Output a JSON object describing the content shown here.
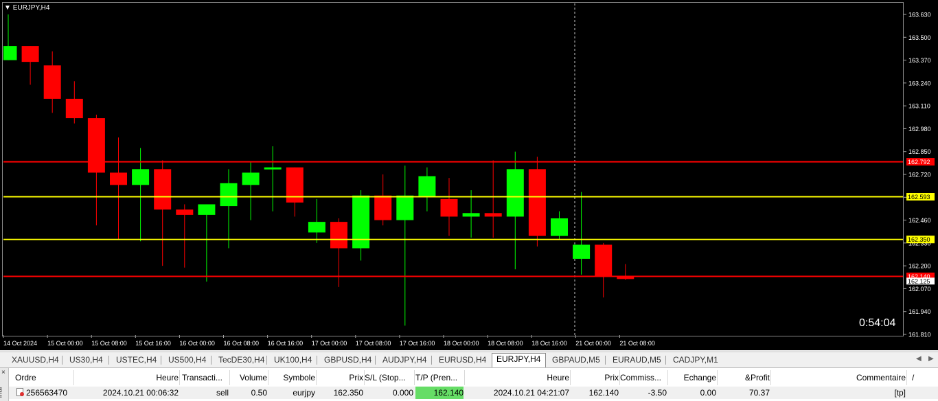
{
  "chart": {
    "symbol": "EURJPY,H4",
    "timer": "0:54:04",
    "colors": {
      "background": "#000000",
      "bull": "#00ff00",
      "bear": "#ff0000",
      "tp_sl_line": "#ff0000",
      "entry_line": "#ffff00"
    },
    "y_min": 161.81,
    "y_max": 163.63,
    "y_ticks": [
      "163.630",
      "163.500",
      "163.370",
      "163.240",
      "163.110",
      "162.980",
      "162.850",
      "162.720",
      "162.590",
      "162.460",
      "162.330",
      "162.200",
      "162.070",
      "161.940",
      "161.810"
    ],
    "x_labels": [
      "14 Oct 2024",
      "15 Oct 00:00",
      "15 Oct 08:00",
      "15 Oct 16:00",
      "16 Oct 00:00",
      "16 Oct 08:00",
      "16 Oct 16:00",
      "17 Oct 00:00",
      "17 Oct 08:00",
      "17 Oct 16:00",
      "18 Oct 00:00",
      "18 Oct 08:00",
      "18 Oct 16:00",
      "21 Oct 00:00",
      "21 Oct 08:00"
    ],
    "price_lines": [
      {
        "label": "162.792",
        "value": 162.792,
        "color": "#ff0000",
        "tag_text": "#ffffff"
      },
      {
        "label": "162.593",
        "value": 162.593,
        "color": "#ffff00",
        "tag_text": "#000000"
      },
      {
        "label": "162.350",
        "value": 162.35,
        "color": "#ffff00",
        "tag_text": "#000000"
      },
      {
        "label": "162.140",
        "value": 162.14,
        "color": "#ff0000",
        "tag_text": "#ffffff"
      }
    ],
    "current_price": "162.125",
    "candles": [
      {
        "o": 163.37,
        "h": 163.63,
        "l": 163.37,
        "c": 163.45
      },
      {
        "o": 163.45,
        "h": 163.45,
        "l": 163.23,
        "c": 163.36
      },
      {
        "o": 163.34,
        "h": 163.42,
        "l": 163.07,
        "c": 163.15
      },
      {
        "o": 163.15,
        "h": 163.25,
        "l": 163.01,
        "c": 163.04
      },
      {
        "o": 163.04,
        "h": 163.06,
        "l": 162.43,
        "c": 162.73
      },
      {
        "o": 162.73,
        "h": 162.93,
        "l": 162.35,
        "c": 162.66
      },
      {
        "o": 162.66,
        "h": 162.87,
        "l": 162.34,
        "c": 162.75
      },
      {
        "o": 162.75,
        "h": 162.8,
        "l": 162.2,
        "c": 162.52
      },
      {
        "o": 162.52,
        "h": 162.55,
        "l": 162.19,
        "c": 162.49
      },
      {
        "o": 162.49,
        "h": 162.55,
        "l": 162.11,
        "c": 162.55
      },
      {
        "o": 162.54,
        "h": 162.75,
        "l": 162.3,
        "c": 162.67
      },
      {
        "o": 162.66,
        "h": 162.79,
        "l": 162.46,
        "c": 162.73
      },
      {
        "o": 162.75,
        "h": 162.88,
        "l": 162.51,
        "c": 162.76
      },
      {
        "o": 162.76,
        "h": 162.76,
        "l": 162.48,
        "c": 162.56
      },
      {
        "o": 162.39,
        "h": 162.58,
        "l": 162.33,
        "c": 162.45
      },
      {
        "o": 162.45,
        "h": 162.47,
        "l": 162.08,
        "c": 162.3
      },
      {
        "o": 162.3,
        "h": 162.63,
        "l": 162.23,
        "c": 162.6
      },
      {
        "o": 162.6,
        "h": 162.72,
        "l": 162.43,
        "c": 162.46
      },
      {
        "o": 162.46,
        "h": 162.77,
        "l": 161.86,
        "c": 162.6
      },
      {
        "o": 162.59,
        "h": 162.76,
        "l": 162.51,
        "c": 162.71
      },
      {
        "o": 162.58,
        "h": 162.7,
        "l": 162.37,
        "c": 162.48
      },
      {
        "o": 162.48,
        "h": 162.63,
        "l": 162.36,
        "c": 162.5
      },
      {
        "o": 162.5,
        "h": 162.8,
        "l": 162.36,
        "c": 162.48
      },
      {
        "o": 162.48,
        "h": 162.85,
        "l": 162.18,
        "c": 162.75
      },
      {
        "o": 162.75,
        "h": 162.82,
        "l": 162.31,
        "c": 162.37
      },
      {
        "o": 162.37,
        "h": 162.51,
        "l": 162.35,
        "c": 162.47
      },
      {
        "o": 162.24,
        "h": 162.62,
        "l": 162.15,
        "c": 162.32
      },
      {
        "o": 162.32,
        "h": 162.33,
        "l": 162.02,
        "c": 162.14
      },
      {
        "o": 162.14,
        "h": 162.21,
        "l": 162.12,
        "c": 162.125
      }
    ]
  },
  "tabs": [
    {
      "label": "XAUUSD,H4",
      "active": false
    },
    {
      "label": "US30,H4",
      "active": false
    },
    {
      "label": "USTEC,H4",
      "active": false
    },
    {
      "label": "US500,H4",
      "active": false
    },
    {
      "label": "TecDE30,H4",
      "active": false
    },
    {
      "label": "UK100,H4",
      "active": false
    },
    {
      "label": "GBPUSD,H4",
      "active": false
    },
    {
      "label": "AUDJPY,H4",
      "active": false
    },
    {
      "label": "EURUSD,H4",
      "active": false
    },
    {
      "label": "EURJPY,H4",
      "active": true
    },
    {
      "label": "GBPAUD,M5",
      "active": false
    },
    {
      "label": "EURAUD,M5",
      "active": false
    },
    {
      "label": "CADJPY,M1",
      "active": false
    }
  ],
  "terminal": {
    "side_label": "inal",
    "close_icon": "×",
    "columns": [
      "Ordre",
      "Heure",
      "Transacti...",
      "Volume",
      "Symbole",
      "Prix",
      "S/L (Stop...",
      "T/P (Pren...",
      "Heure",
      "Prix",
      "Commiss...",
      "Echange",
      "&Profit",
      "Commentaire"
    ],
    "sort_indicator": "/",
    "row": {
      "order": "256563470",
      "open_time": "2024.10.21 00:06:32",
      "type": "sell",
      "volume": "0.50",
      "symbol": "eurjpy",
      "open_price": "162.350",
      "sl": "0.000",
      "tp": "162.140",
      "close_time": "2024.10.21 04:21:07",
      "close_price": "162.140",
      "commission": "-3.50",
      "swap": "0.00",
      "profit": "70.37",
      "comment": "[tp]"
    }
  }
}
